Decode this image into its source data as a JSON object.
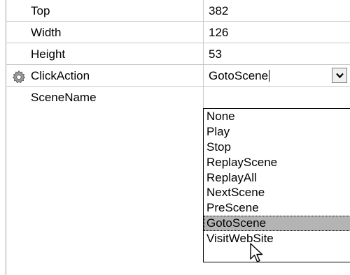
{
  "properties": [
    {
      "name": "Top",
      "value": "382"
    },
    {
      "name": "Width",
      "value": "126"
    },
    {
      "name": "Height",
      "value": "53"
    },
    {
      "name": "ClickAction",
      "value": "GotoScene",
      "icon": "gear-icon"
    },
    {
      "name": "SceneName",
      "value": ""
    }
  ],
  "dropdown": {
    "options": [
      "None",
      "Play",
      "Stop",
      "ReplayScene",
      "ReplayAll",
      "NextScene",
      "PreScene",
      "GotoScene",
      "VisitWebSite"
    ],
    "selected": "GotoScene"
  },
  "colors": {
    "grid_line": "#c8c8c8",
    "selected_bg": "#b4b4b4"
  }
}
